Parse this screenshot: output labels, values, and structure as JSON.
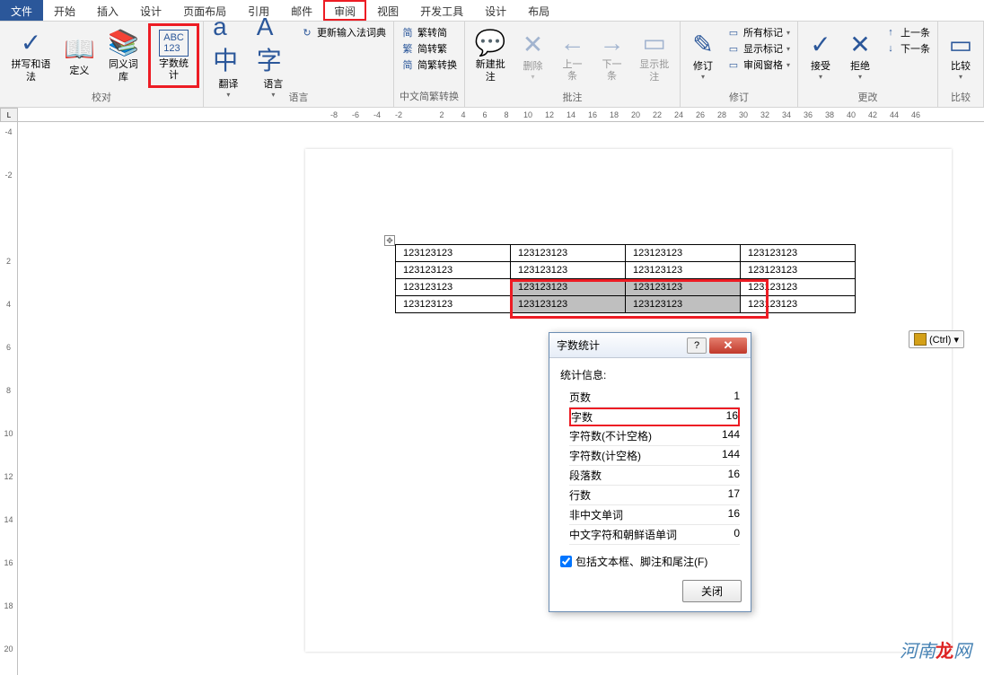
{
  "menu": {
    "items": [
      "文件",
      "开始",
      "插入",
      "设计",
      "页面布局",
      "引用",
      "邮件",
      "审阅",
      "视图",
      "开发工具",
      "设计",
      "布局"
    ],
    "active_file_index": 0,
    "highlighted_index": 7
  },
  "ribbon": {
    "groups": [
      {
        "label": "校对",
        "buttons": [
          {
            "label": "拼写和语法",
            "icon": "✓"
          },
          {
            "label": "定义",
            "icon": "📖"
          },
          {
            "label": "同义词库",
            "icon": "📚"
          },
          {
            "label": "字数统计",
            "icon": "123",
            "highlighted": true,
            "icon_top": "ABC"
          }
        ]
      },
      {
        "label": "语言",
        "buttons": [
          {
            "label": "翻译",
            "icon": "a中",
            "dropdown": true
          },
          {
            "label": "语言",
            "icon": "A字",
            "dropdown": true
          }
        ],
        "small_items": [
          {
            "icon": "↻",
            "label": "更新输入法词典"
          }
        ]
      },
      {
        "label": "中文简繁转换",
        "small_items": [
          {
            "icon": "简",
            "label": "繁转简"
          },
          {
            "icon": "繁",
            "label": "简转繁"
          },
          {
            "icon": "简",
            "label": "简繁转换"
          }
        ]
      },
      {
        "label": "批注",
        "buttons": [
          {
            "label": "新建批注",
            "icon": "💬"
          },
          {
            "label": "删除",
            "icon": "✕",
            "dropdown": true,
            "disabled": true
          },
          {
            "label": "上一条",
            "icon": "←",
            "disabled": true
          },
          {
            "label": "下一条",
            "icon": "→",
            "disabled": true
          },
          {
            "label": "显示批注",
            "icon": "▭",
            "disabled": true
          }
        ]
      },
      {
        "label": "修订",
        "buttons": [
          {
            "label": "修订",
            "icon": "✎",
            "dropdown": true
          }
        ],
        "small_items": [
          {
            "icon": "▭",
            "label": "所有标记",
            "dropdown": true
          },
          {
            "icon": "▭",
            "label": "显示标记",
            "dropdown": true
          },
          {
            "icon": "▭",
            "label": "审阅窗格",
            "dropdown": true
          }
        ]
      },
      {
        "label": "更改",
        "buttons": [
          {
            "label": "接受",
            "icon": "✓",
            "dropdown": true
          },
          {
            "label": "拒绝",
            "icon": "✕",
            "dropdown": true
          }
        ],
        "small_items": [
          {
            "icon": "↑",
            "label": "上一条"
          },
          {
            "icon": "↓",
            "label": "下一条"
          }
        ]
      },
      {
        "label": "比较",
        "buttons": [
          {
            "label": "比较",
            "icon": "▭",
            "dropdown": true
          }
        ]
      }
    ]
  },
  "ruler_h": [
    "-8",
    "-6",
    "-4",
    "-2",
    "",
    "2",
    "4",
    "6",
    "8",
    "10",
    "12",
    "14",
    "16",
    "18",
    "20",
    "22",
    "24",
    "26",
    "28",
    "30",
    "32",
    "34",
    "36",
    "38",
    "40",
    "42",
    "44",
    "46"
  ],
  "ruler_v": [
    "-4",
    "",
    "-2",
    "",
    "",
    "",
    "2",
    "",
    "4",
    "",
    "6",
    "",
    "8",
    "",
    "10",
    "",
    "12",
    "",
    "14",
    "",
    "16",
    "",
    "18",
    "",
    "20"
  ],
  "table": {
    "rows": [
      [
        "123123123",
        "123123123",
        "123123123",
        "123123123"
      ],
      [
        "123123123",
        "123123123",
        "123123123",
        "123123123"
      ],
      [
        "123123123",
        "123123123",
        "123123123",
        "123123123"
      ],
      [
        "123123123",
        "123123123",
        "123123123",
        "123123123"
      ]
    ],
    "selected_cells": [
      [
        2,
        1
      ],
      [
        2,
        2
      ],
      [
        3,
        1
      ],
      [
        3,
        2
      ]
    ]
  },
  "ctrl_button": {
    "label": "(Ctrl) ▾"
  },
  "dialog": {
    "title": "字数统计",
    "section_label": "统计信息:",
    "stats": [
      {
        "label": "页数",
        "value": "1"
      },
      {
        "label": "字数",
        "value": "16",
        "highlighted": true
      },
      {
        "label": "字符数(不计空格)",
        "value": "144"
      },
      {
        "label": "字符数(计空格)",
        "value": "144"
      },
      {
        "label": "段落数",
        "value": "16"
      },
      {
        "label": "行数",
        "value": "17"
      },
      {
        "label": "非中文单词",
        "value": "16"
      },
      {
        "label": "中文字符和朝鲜语单词",
        "value": "0"
      }
    ],
    "checkbox_label": "包括文本框、脚注和尾注(F)",
    "checkbox_checked": true,
    "close_label": "关闭"
  },
  "watermark": {
    "text1": "河南",
    "text2": "龙",
    "text3": "网"
  }
}
